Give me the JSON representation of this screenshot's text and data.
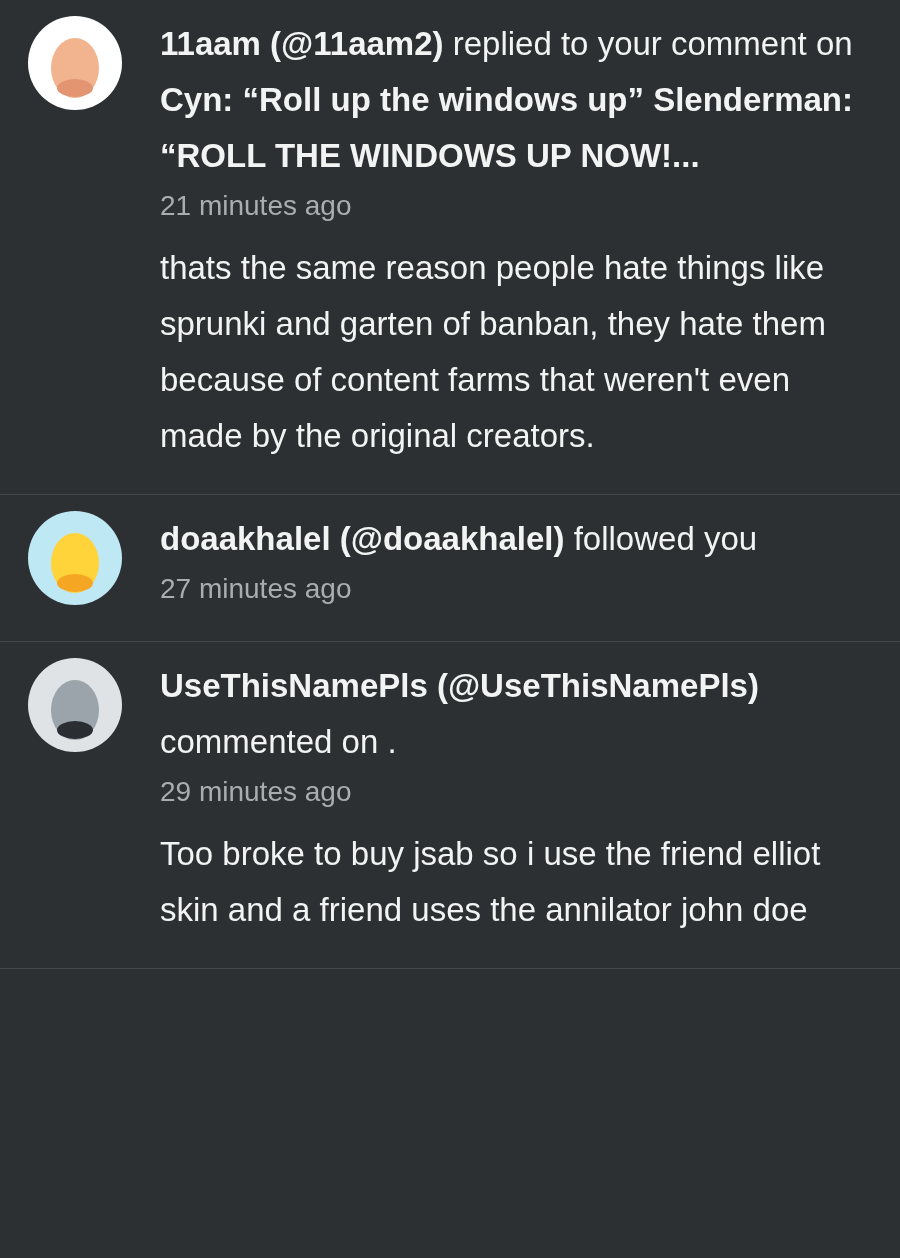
{
  "notifications": [
    {
      "headline": "**11aam (@11aam2)** replied to your comment on **Cyn: “Roll up the windows up” Slenderman: “ROLL THE WINDOWS UP NOW!...**",
      "time": "21 minutes ago",
      "body": "thats the same reason people hate things like sprunki and garten of banban, they hate them because of content farms that weren't even made by the original creators."
    },
    {
      "headline": "**doaakhalel (@doaakhalel)** followed you",
      "time": "27 minutes ago"
    },
    {
      "headline": "**UseThisNamePls (@UseThisNamePls)** commented on .",
      "time": "29 minutes ago",
      "body": "Too broke to buy jsab so i use the friend elliot skin and a friend uses the annilator john doe"
    }
  ]
}
